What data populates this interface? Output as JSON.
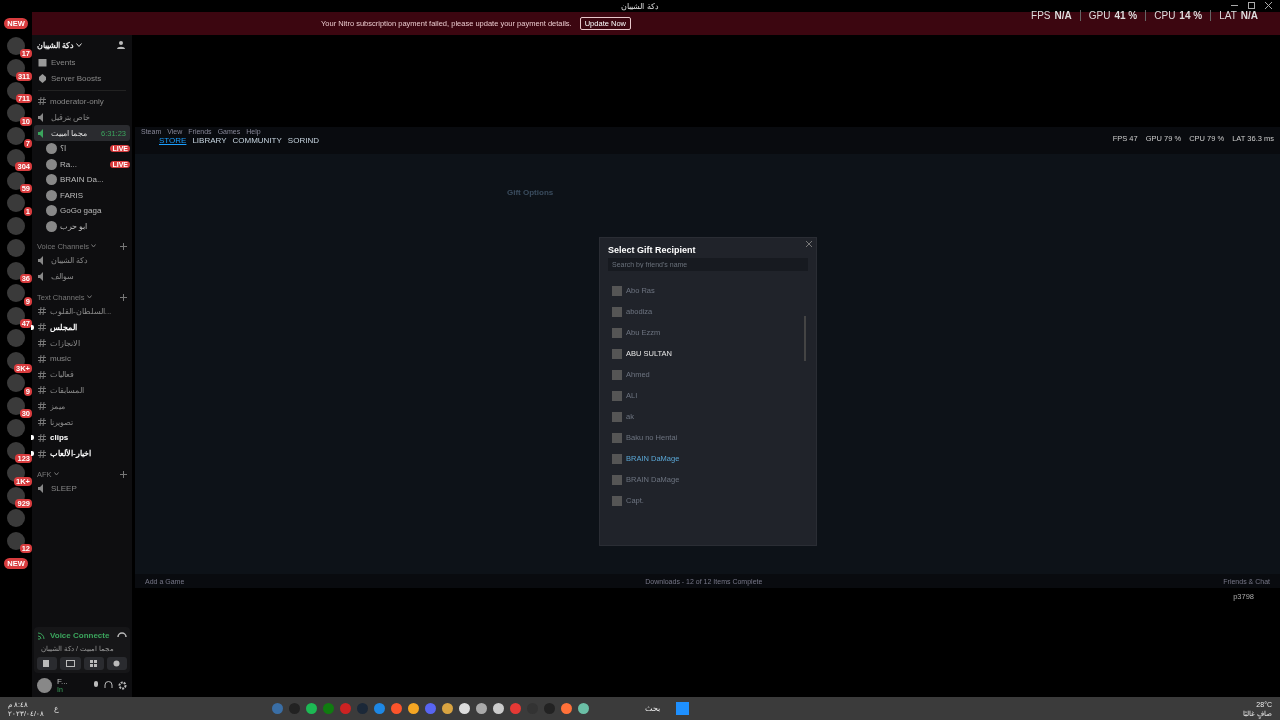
{
  "window": {
    "title": "دكة الشيبان"
  },
  "banner": {
    "message": "Your Nitro subscription payment failed, please update your payment details.",
    "button": "Update Now"
  },
  "overlay_stats": [
    {
      "label": "FPS",
      "value": "N/A"
    },
    {
      "label": "GPU",
      "value": "41 %"
    },
    {
      "label": "CPU",
      "value": "14 %"
    },
    {
      "label": "LAT",
      "value": "N/A"
    }
  ],
  "servers": [
    {
      "badge": "NEW",
      "kind": "new"
    },
    {
      "badge": "17",
      "kind": "server"
    },
    {
      "badge": "311",
      "kind": "server"
    },
    {
      "badge": "711",
      "kind": "server"
    },
    {
      "badge": "10",
      "kind": "server"
    },
    {
      "badge": "7",
      "kind": "server"
    },
    {
      "badge": "304",
      "kind": "server"
    },
    {
      "badge": "59",
      "kind": "server"
    },
    {
      "badge": "1",
      "kind": "server"
    },
    {
      "kind": "server"
    },
    {
      "kind": "server"
    },
    {
      "badge": "36",
      "kind": "server"
    },
    {
      "badge": "9",
      "kind": "server"
    },
    {
      "badge": "47",
      "kind": "server"
    },
    {
      "kind": "server"
    },
    {
      "badge": "3K+",
      "kind": "server"
    },
    {
      "badge": "9",
      "kind": "server"
    },
    {
      "badge": "30",
      "kind": "server"
    },
    {
      "kind": "server"
    },
    {
      "badge": "123",
      "kind": "server"
    },
    {
      "badge": "1K+",
      "kind": "server"
    },
    {
      "badge": "929",
      "kind": "server"
    },
    {
      "kind": "server"
    },
    {
      "badge": "12",
      "kind": "server"
    },
    {
      "badge": "NEW",
      "kind": "new"
    }
  ],
  "sidebar": {
    "server_name": "دكة الشيبان",
    "shortcuts": [
      {
        "label": "Events",
        "kind": "calendar"
      },
      {
        "label": "Server Boosts",
        "kind": "boost"
      }
    ],
    "top_channels": [
      {
        "name": "moderator-only",
        "kind": "text",
        "selected": false,
        "unread": false
      },
      {
        "name": "خاص بترقيل",
        "kind": "voice",
        "selected": false,
        "unread": false
      },
      {
        "name": "مجما امبيت",
        "kind": "voice",
        "selected": true,
        "unread": false,
        "timer": "6:31:23"
      }
    ],
    "voice_users": [
      {
        "name": "ا؟",
        "badge": "LIVE"
      },
      {
        "name": "Ra...",
        "badge": "LIVE"
      },
      {
        "name": "BRAIN Da..."
      },
      {
        "name": "FARIS"
      },
      {
        "name": "GoGo gaga"
      },
      {
        "name": "ابو حرب"
      }
    ],
    "categories": [
      {
        "name": "Voice Channels",
        "channels": [
          {
            "name": "دكة الشيبان",
            "kind": "voice",
            "selected": false,
            "unread": false
          },
          {
            "name": "سوالف",
            "kind": "voice",
            "selected": false,
            "unread": false
          }
        ]
      },
      {
        "name": "Text Channels",
        "channels": [
          {
            "name": "السلطان-القلوب...",
            "kind": "text",
            "selected": false,
            "unread": false
          },
          {
            "name": "المجلس",
            "kind": "text",
            "selected": false,
            "unread": true
          },
          {
            "name": "الانجازات",
            "kind": "text",
            "selected": false,
            "unread": false
          },
          {
            "name": "music",
            "kind": "text",
            "selected": false,
            "unread": false
          },
          {
            "name": "فعاليات",
            "kind": "text",
            "selected": false,
            "unread": false
          },
          {
            "name": "المسابقات",
            "kind": "text",
            "selected": false,
            "unread": false
          },
          {
            "name": "ميمز",
            "kind": "text",
            "selected": false,
            "unread": false
          },
          {
            "name": "تصويرنا",
            "kind": "text",
            "selected": false,
            "unread": false
          },
          {
            "name": "clips",
            "kind": "text",
            "selected": false,
            "unread": true
          },
          {
            "name": "اخبار-الألعاب",
            "kind": "text",
            "selected": false,
            "unread": true
          }
        ]
      },
      {
        "name": "AFK",
        "channels": [
          {
            "name": "SLEEP",
            "kind": "voice",
            "selected": false,
            "unread": false
          }
        ]
      }
    ]
  },
  "voice_panel": {
    "status": "Voice Connecte",
    "location": "مجما امبيت / دكة الشيبان"
  },
  "user_panel": {
    "name": "F...",
    "status": "In"
  },
  "steam": {
    "menu": [
      "Steam",
      "View",
      "Friends",
      "Games",
      "Help"
    ],
    "tabs": [
      {
        "label": "STORE",
        "selected": true
      },
      {
        "label": "LIBRARY",
        "selected": false
      },
      {
        "label": "COMMUNITY",
        "selected": false
      },
      {
        "label": "SORIND",
        "selected": false
      }
    ],
    "stats": [
      {
        "label": "FPS",
        "value": "47"
      },
      {
        "label": "GPU",
        "value": "79 %"
      },
      {
        "label": "CPU",
        "value": "79 %"
      },
      {
        "label": "LAT",
        "value": "36.3 ms"
      }
    ],
    "page_title": "Gift Options",
    "bottom_left": "Add a Game",
    "bottom_center": "Downloads - 12 of 12 Items Complete",
    "bottom_right": "Friends & Chat",
    "modal": {
      "title": "Select Gift Recipient",
      "search_placeholder": "Search by friend's name",
      "friends": [
        {
          "name": "Abo Ras",
          "online": false,
          "in_game": false
        },
        {
          "name": "abodiza",
          "online": false,
          "in_game": false
        },
        {
          "name": "Abu Ezzm",
          "online": false,
          "in_game": false
        },
        {
          "name": "ABU SULTAN",
          "online": true
        },
        {
          "name": "Ahmed",
          "online": false,
          "in_game": false
        },
        {
          "name": "ALI",
          "online": false,
          "in_game": false
        },
        {
          "name": "ak",
          "online": false,
          "in_game": false
        },
        {
          "name": "Baku no Hentai",
          "online": false,
          "in_game": false
        },
        {
          "name": "BRAIN DaMage",
          "online": false,
          "in_game": true
        },
        {
          "name": "BRAIN DaMage",
          "online": false,
          "in_game": false
        },
        {
          "name": "Capt.",
          "online": false,
          "in_game": false
        }
      ]
    }
  },
  "corner_label": "p3798",
  "taskbar": {
    "clock_time": "٨:٤٨ م",
    "clock_date": "٢٠٢٣/٠٤/٠٨",
    "language": "ع",
    "search": "بحث",
    "weather_temp": "28°C",
    "weather_text": "صافٍ غالبًا"
  }
}
